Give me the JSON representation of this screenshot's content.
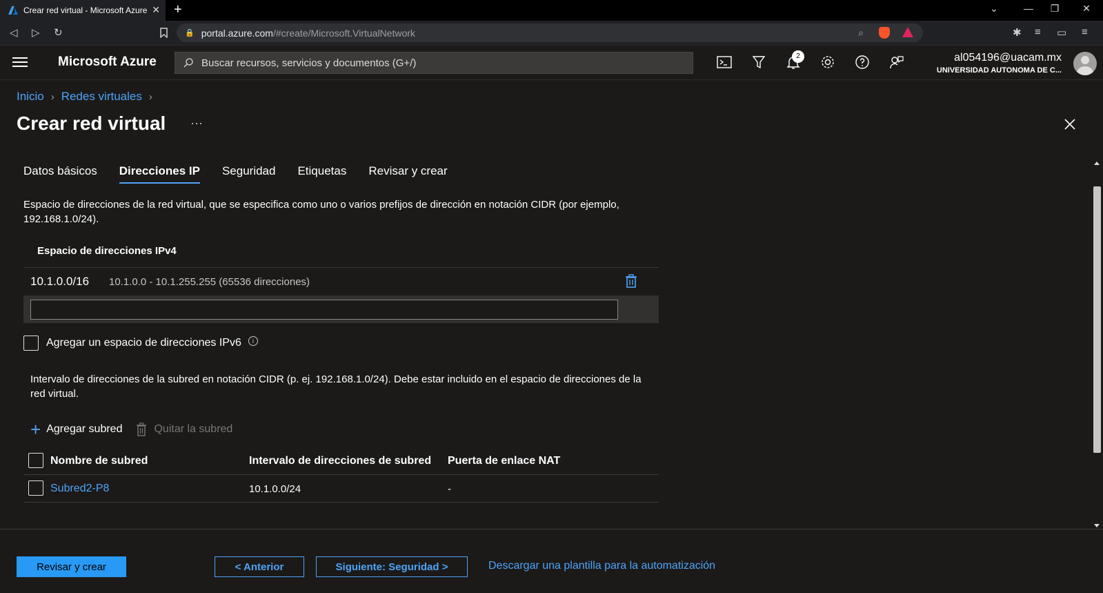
{
  "browser": {
    "tab_title": "Crear red virtual - Microsoft Azure",
    "url_host": "portal.azure.com",
    "url_path": "/#create/Microsoft.VirtualNetwork"
  },
  "header": {
    "brand": "Microsoft Azure",
    "search_placeholder": "Buscar recursos, servicios y documentos (G+/)",
    "notifications_count": "2",
    "user_email": "al054196@uacam.mx",
    "user_org": "UNIVERSIDAD AUTONOMA DE C..."
  },
  "breadcrumb": {
    "items": [
      "Inicio",
      "Redes virtuales"
    ]
  },
  "page": {
    "title": "Crear red virtual",
    "more": "···"
  },
  "tabs": [
    {
      "label": "Datos básicos"
    },
    {
      "label": "Direcciones IP"
    },
    {
      "label": "Seguridad"
    },
    {
      "label": "Etiquetas"
    },
    {
      "label": "Revisar y crear"
    }
  ],
  "ip": {
    "description": "Espacio de direcciones de la red virtual, que se especifica como uno o varios prefijos de dirección en notación CIDR (por ejemplo, 192.168.1.0/24).",
    "ipv4_label": "Espacio de direcciones IPv4",
    "address": {
      "cidr": "10.1.0.0/16",
      "range": "10.1.0.0 - 10.1.255.255 (65536 direcciones)"
    },
    "new_address_value": "",
    "ipv6_label": "Agregar un espacio de direcciones IPv6",
    "subnet_description": "Intervalo de direcciones de la subred en notación CIDR (p. ej. 192.168.1.0/24). Debe estar incluido en el espacio de direcciones de la red virtual."
  },
  "subnets": {
    "add_label": "Agregar subred",
    "remove_label": "Quitar la subred",
    "columns": [
      "Nombre de subred",
      "Intervalo de direcciones de subred",
      "Puerta de enlace NAT"
    ],
    "rows": [
      {
        "name": "Subred2-P8",
        "range": "10.1.0.0/24",
        "nat": "-"
      }
    ]
  },
  "footer": {
    "review_create": "Revisar y crear",
    "previous": "< Anterior",
    "next": "Siguiente: Seguridad >",
    "download": "Descargar una plantilla para la automatización"
  },
  "colors": {
    "accent": "#4fa3f7",
    "primary_button": "#2899f5",
    "background": "#1b1a19"
  }
}
